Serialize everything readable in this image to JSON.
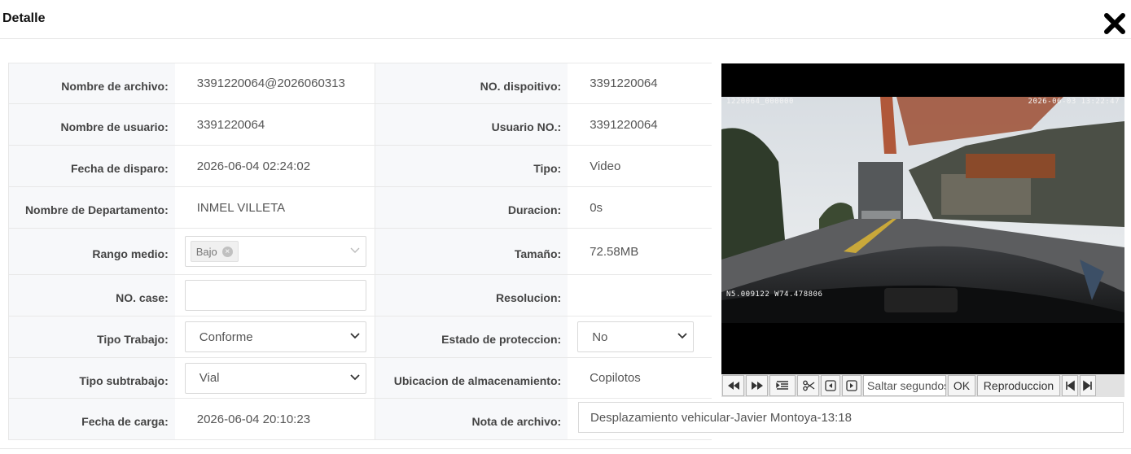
{
  "dialog": {
    "title": "Detalle"
  },
  "fields": {
    "filename_label": "Nombre de archivo:",
    "filename_value": "3391220064@2026060313",
    "device_label": "NO. dispoitivo:",
    "device_value": "3391220064",
    "username_label": "Nombre de usuario:",
    "username_value": "3391220064",
    "userno_label": "Usuario NO.:",
    "userno_value": "3391220064",
    "trigger_label": "Fecha de disparo:",
    "trigger_value": "2026-06-04 02:24:02",
    "type_label": "Tipo:",
    "type_value": "Video",
    "dept_label": "Nombre de Departamento:",
    "dept_value": "INMEL VILLETA",
    "duration_label": "Duracion:",
    "duration_value": "0s",
    "range_label": "Rango medio:",
    "range_tag": "Bajo",
    "size_label": "Tamaño:",
    "size_value": "72.58MB",
    "case_label": "NO. case:",
    "case_value": "",
    "resolution_label": "Resolucion:",
    "resolution_value": "",
    "worktype_label": "Tipo Trabajo:",
    "worktype_value": "Conforme",
    "protection_label": "Estado de proteccion:",
    "protection_value": "No",
    "subwork_label": "Tipo subtrabajo:",
    "subwork_value": "Vial",
    "storage_label": "Ubicacion de almacenamiento:",
    "storage_value": "Copilotos",
    "upload_label": "Fecha de carga:",
    "upload_value": "2026-06-04 20:10:23",
    "note_label": "Nota de archivo:",
    "note_value": "Desplazamiento vehicular-Javier Montoya-13:18"
  },
  "video": {
    "osd_top_left": "1220064_000000",
    "osd_top_right": "2026-06-03  13:22:47",
    "osd_gps": "N5.009122  W74.478806"
  },
  "controls": {
    "seek_placeholder": "Saltar segundos",
    "ok_label": "OK",
    "playback_label": "Reproduccion"
  }
}
